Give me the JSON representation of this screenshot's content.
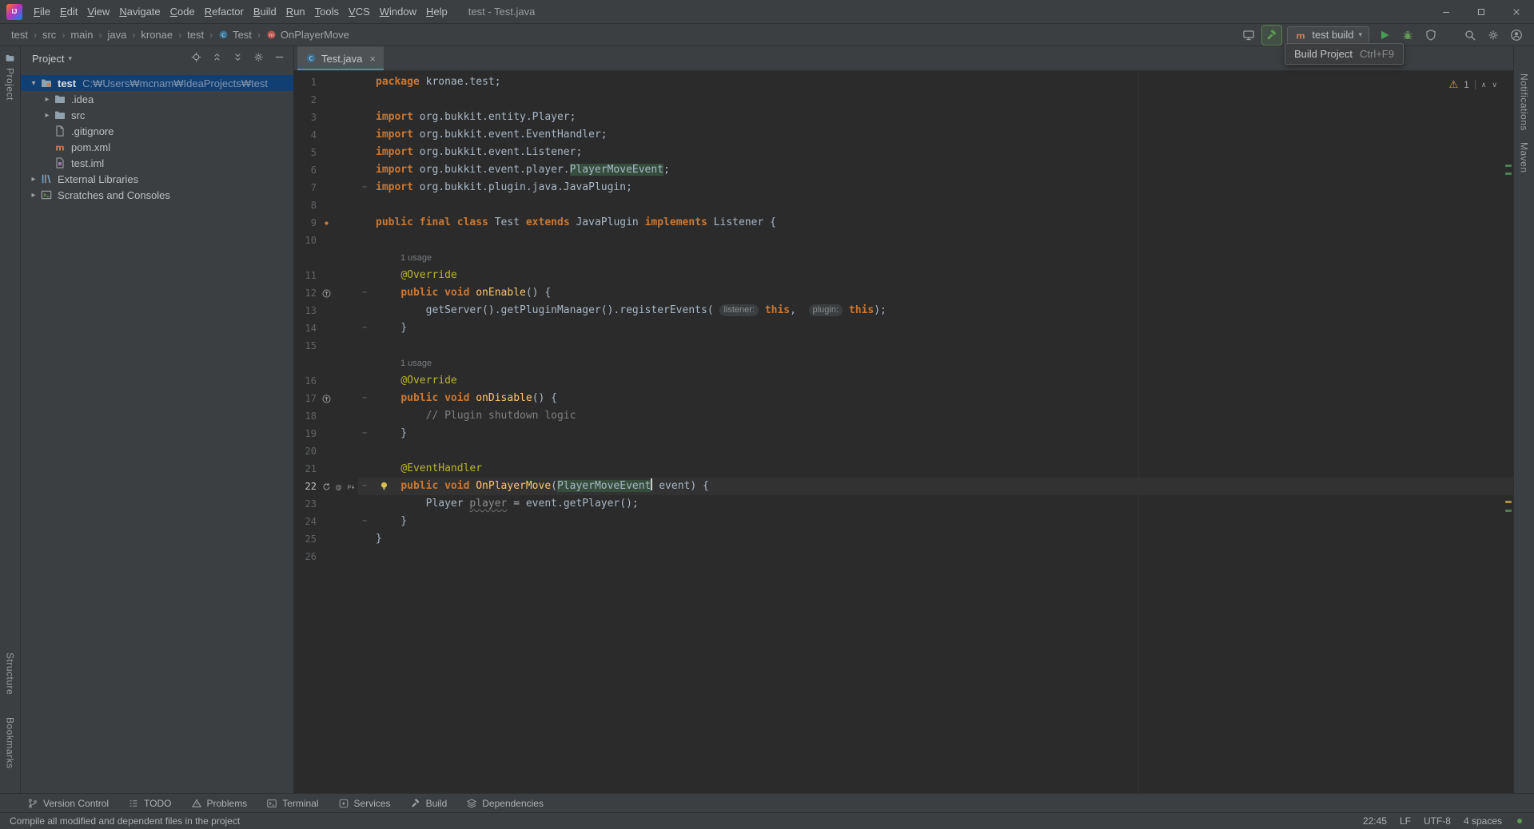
{
  "colors": {
    "bg-panel": "#3c3f41",
    "bg-editor": "#2b2b2b",
    "border": "#2d2f30",
    "keyword": "#cc7832",
    "annotation": "#bbb529",
    "method": "#ffc66b",
    "comment": "#808080",
    "code-default": "#a9b7c6",
    "line-number": "#606366",
    "current-line": "#323232",
    "selection": "#103f73",
    "ident-highlight": "#344d3c",
    "tab-active": "#4e5254",
    "tab-underline": "#4a88c7",
    "warning": "#d9a343",
    "run-green": "#499c54",
    "hint-bg": "#3b3e40",
    "hint-text": "#8c8c8c"
  },
  "window": {
    "title": "test - Test.java",
    "menus": [
      "File",
      "Edit",
      "View",
      "Navigate",
      "Code",
      "Refactor",
      "Build",
      "Run",
      "Tools",
      "VCS",
      "Window",
      "Help"
    ],
    "controls": [
      "minimize",
      "maximize",
      "close"
    ]
  },
  "breadcrumbs": [
    {
      "label": "test"
    },
    {
      "label": "src"
    },
    {
      "label": "main"
    },
    {
      "label": "java"
    },
    {
      "label": "kronae"
    },
    {
      "label": "test"
    },
    {
      "label": "Test",
      "icon": "class"
    },
    {
      "label": "OnPlayerMove",
      "icon": "method"
    }
  ],
  "toolbar": {
    "pre": [
      {
        "name": "code-with-me"
      },
      {
        "name": "build-hammer",
        "highlighted": true
      }
    ],
    "config": {
      "icon": "maven",
      "label": "test build"
    },
    "post": [
      "run",
      "debug",
      "coverage"
    ],
    "far": [
      "search",
      "settings",
      "avatar"
    ]
  },
  "tooltip": {
    "label": "Build Project",
    "shortcut": "Ctrl+F9"
  },
  "stripes": {
    "left_top": [
      "Project"
    ],
    "left_bottom": [
      "Structure",
      "Bookmarks"
    ],
    "right": [
      "Notifications",
      "Maven"
    ]
  },
  "project_panel": {
    "title": "Project",
    "header_icons": [
      "locate",
      "expand-all",
      "collapse-all",
      "settings",
      "hide"
    ],
    "items": [
      {
        "label": "test",
        "path": "C:₩Users₩mcnam₩IdeaProjects₩test",
        "icon": "folder-project",
        "chevron": "v",
        "level": 0,
        "selected": true,
        "bold": true
      },
      {
        "label": ".idea",
        "icon": "folder",
        "chevron": ">",
        "level": 1
      },
      {
        "label": "src",
        "icon": "folder",
        "chevron": ">",
        "level": 1
      },
      {
        "label": ".gitignore",
        "icon": "file",
        "chevron": "",
        "level": 1
      },
      {
        "label": "pom.xml",
        "icon": "maven",
        "chevron": "",
        "level": 1
      },
      {
        "label": "test.iml",
        "icon": "module",
        "chevron": "",
        "level": 1
      },
      {
        "label": "External Libraries",
        "icon": "libs",
        "chevron": ">",
        "level": 0
      },
      {
        "label": "Scratches and Consoles",
        "icon": "scratch",
        "chevron": ">",
        "level": 0
      }
    ]
  },
  "editor": {
    "tab": "Test.java",
    "tab_close": "×",
    "inspection": {
      "warning_count": "1"
    },
    "rows": [
      {
        "n": "1",
        "seg": [
          [
            "k",
            "package"
          ],
          [
            "p",
            " kronae.test;"
          ]
        ]
      },
      {
        "n": "2",
        "seg": []
      },
      {
        "n": "3",
        "seg": [
          [
            "k",
            "import"
          ],
          [
            "p",
            " org.bukkit.entity.Player;"
          ]
        ]
      },
      {
        "n": "4",
        "seg": [
          [
            "k",
            "import"
          ],
          [
            "p",
            " org.bukkit.event.EventHandler;"
          ]
        ]
      },
      {
        "n": "5",
        "seg": [
          [
            "k",
            "import"
          ],
          [
            "p",
            " org.bukkit.event.Listener;"
          ]
        ]
      },
      {
        "n": "6",
        "seg": [
          [
            "k",
            "import"
          ],
          [
            "p",
            " org.bukkit.event.player."
          ],
          [
            "g",
            "PlayerMoveEvent"
          ],
          [
            "p",
            ";"
          ]
        ]
      },
      {
        "n": "7",
        "fold": true,
        "seg": [
          [
            "k",
            "import"
          ],
          [
            "p",
            " org.bukkit.plugin.java.JavaPlugin;"
          ]
        ]
      },
      {
        "n": "8",
        "seg": []
      },
      {
        "n": "9",
        "icons": [
          "dot"
        ],
        "seg": [
          [
            "k",
            "public final class"
          ],
          [
            "p",
            " Test "
          ],
          [
            "k",
            "extends"
          ],
          [
            "p",
            " JavaPlugin "
          ],
          [
            "k",
            "implements"
          ],
          [
            "p",
            " Listener {"
          ]
        ]
      },
      {
        "n": "10",
        "seg": []
      },
      {
        "inlay": "1 usage"
      },
      {
        "n": "11",
        "seg": [
          [
            "p",
            "    "
          ],
          [
            "a",
            "@Override"
          ]
        ]
      },
      {
        "n": "12",
        "icons": [
          "override"
        ],
        "fold": true,
        "seg": [
          [
            "p",
            "    "
          ],
          [
            "k",
            "public void"
          ],
          [
            "p",
            " "
          ],
          [
            "m",
            "onEnable"
          ],
          [
            "p",
            "() {"
          ]
        ]
      },
      {
        "n": "13",
        "seg": [
          [
            "p",
            "        getServer().getPluginManager().registerEvents( "
          ],
          [
            "h",
            "listener:"
          ],
          [
            "p",
            " "
          ],
          [
            "k",
            "this"
          ],
          [
            "p",
            ",  "
          ],
          [
            "h",
            "plugin:"
          ],
          [
            "p",
            " "
          ],
          [
            "k",
            "this"
          ],
          [
            "p",
            ");"
          ]
        ]
      },
      {
        "n": "14",
        "fold": true,
        "seg": [
          [
            "p",
            "    }"
          ]
        ]
      },
      {
        "n": "15",
        "seg": []
      },
      {
        "inlay": "1 usage"
      },
      {
        "n": "16",
        "seg": [
          [
            "p",
            "    "
          ],
          [
            "a",
            "@Override"
          ]
        ]
      },
      {
        "n": "17",
        "icons": [
          "override"
        ],
        "fold": true,
        "seg": [
          [
            "p",
            "    "
          ],
          [
            "k",
            "public void"
          ],
          [
            "p",
            " "
          ],
          [
            "m",
            "onDisable"
          ],
          [
            "p",
            "() {"
          ]
        ]
      },
      {
        "n": "18",
        "seg": [
          [
            "p",
            "        "
          ],
          [
            "c",
            "// Plugin shutdown logic"
          ]
        ]
      },
      {
        "n": "19",
        "fold": true,
        "seg": [
          [
            "p",
            "    }"
          ]
        ]
      },
      {
        "n": "20",
        "seg": []
      },
      {
        "n": "21",
        "seg": [
          [
            "p",
            "    "
          ],
          [
            "a",
            "@EventHandler"
          ]
        ]
      },
      {
        "n": "22",
        "icons": [
          "sync",
          "at",
          "sub"
        ],
        "fold": true,
        "bulb": true,
        "current": true,
        "seg": [
          [
            "p",
            "    "
          ],
          [
            "k",
            "public void"
          ],
          [
            "p",
            " "
          ],
          [
            "m",
            "OnPlayerMove"
          ],
          [
            "p",
            "("
          ],
          [
            "g",
            "PlayerMoveEvent"
          ],
          [
            "caret",
            ""
          ],
          [
            "p",
            " event) {"
          ]
        ]
      },
      {
        "n": "23",
        "seg": [
          [
            "p",
            "        Player "
          ],
          [
            "u",
            "player"
          ],
          [
            "p",
            " = event.getPlayer();"
          ]
        ]
      },
      {
        "n": "24",
        "fold": true,
        "seg": [
          [
            "p",
            "    }"
          ]
        ]
      },
      {
        "n": "25",
        "seg": [
          [
            "p",
            "}"
          ]
        ]
      },
      {
        "n": "26",
        "seg": []
      }
    ]
  },
  "bottom_bar": [
    {
      "label": "Version Control",
      "icon": "branch"
    },
    {
      "label": "TODO",
      "icon": "todo"
    },
    {
      "label": "Problems",
      "icon": "problems"
    },
    {
      "label": "Terminal",
      "icon": "terminal"
    },
    {
      "label": "Services",
      "icon": "services"
    },
    {
      "label": "Build",
      "icon": "hammer"
    },
    {
      "label": "Dependencies",
      "icon": "layers"
    }
  ],
  "status": {
    "message": "Compile all modified and dependent files in the project",
    "caret": "22:45",
    "line_separator": "LF",
    "encoding": "UTF-8",
    "indent": "4 spaces"
  }
}
